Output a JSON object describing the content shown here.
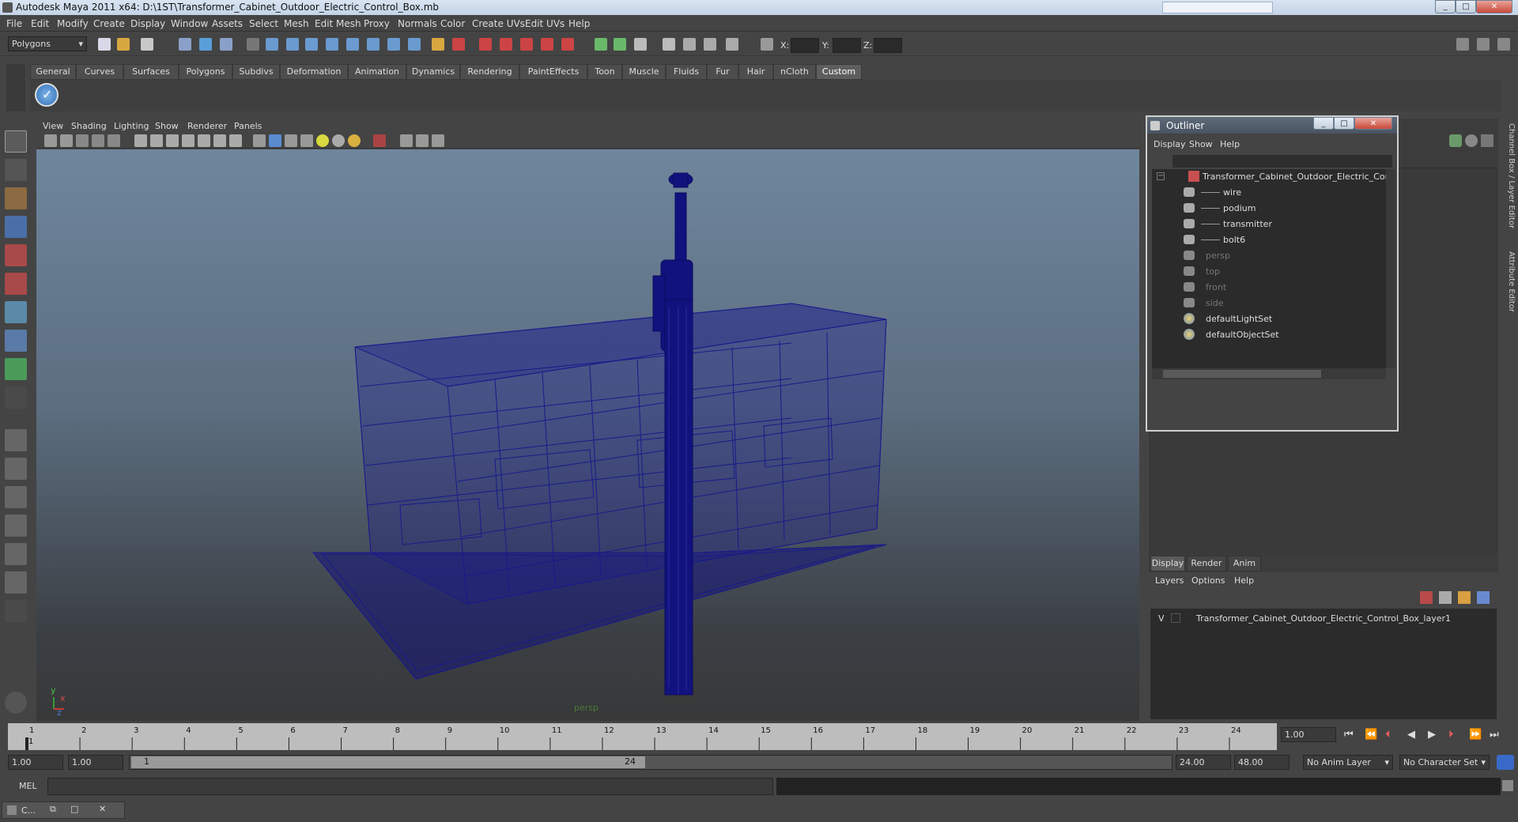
{
  "window": {
    "title": "Autodesk Maya 2011 x64: D:\\1ST\\Transformer_Cabinet_Outdoor_Electric_Control_Box.mb",
    "controls": [
      "_",
      "□",
      "✕"
    ]
  },
  "menu": [
    "File",
    "Edit",
    "Modify",
    "Create",
    "Display",
    "Window",
    "Assets",
    "Select",
    "Mesh",
    "Edit Mesh",
    "Proxy",
    "Normals",
    "Color",
    "Create UVs",
    "Edit UVs",
    "Help"
  ],
  "status_line": {
    "mode": "Polygons",
    "x_label": "X:",
    "y_label": "Y:",
    "z_label": "Z:"
  },
  "shelf": {
    "tabs": [
      "General",
      "Curves",
      "Surfaces",
      "Polygons",
      "Subdivs",
      "Deformation",
      "Animation",
      "Dynamics",
      "Rendering",
      "PaintEffects",
      "Toon",
      "Muscle",
      "Fluids",
      "Fur",
      "Hair",
      "nCloth",
      "Custom"
    ],
    "active_tab": "Custom"
  },
  "viewport": {
    "menu": [
      "View",
      "Shading",
      "Lighting",
      "Show",
      "Renderer",
      "Panels"
    ],
    "camera_label": "persp",
    "axis_y": "y",
    "axis_x": "x",
    "axis_z": "z"
  },
  "outliner": {
    "title": "Outliner",
    "menu": [
      "Display",
      "Show",
      "Help"
    ],
    "items": [
      {
        "label": "Transformer_Cabinet_Outdoor_Electric_Cont",
        "dim": false
      },
      {
        "label": "wire",
        "dim": false
      },
      {
        "label": "podium",
        "dim": false
      },
      {
        "label": "transmitter",
        "dim": false
      },
      {
        "label": "bolt6",
        "dim": false
      },
      {
        "label": "persp",
        "dim": true
      },
      {
        "label": "top",
        "dim": true
      },
      {
        "label": "front",
        "dim": true
      },
      {
        "label": "side",
        "dim": true
      },
      {
        "label": "defaultLightSet",
        "dim": false
      },
      {
        "label": "defaultObjectSet",
        "dim": false
      }
    ]
  },
  "side_tabs": [
    "Channel Box / Layer Editor",
    "Attribute Editor"
  ],
  "layer_editor": {
    "tabs": [
      "Display",
      "Render",
      "Anim"
    ],
    "active_tab": "Display",
    "menu": [
      "Layers",
      "Options",
      "Help"
    ],
    "layer": {
      "visible": "V",
      "name": "Transformer_Cabinet_Outdoor_Electric_Control_Box_layer1"
    }
  },
  "time_slider": {
    "ticks": [
      "1",
      "2",
      "3",
      "4",
      "5",
      "6",
      "7",
      "8",
      "9",
      "10",
      "11",
      "12",
      "13",
      "14",
      "15",
      "16",
      "17",
      "18",
      "19",
      "20",
      "21",
      "22",
      "23",
      "24"
    ],
    "current_frame": "1",
    "current_time_field": "1.00"
  },
  "range_slider": {
    "start_time": "1.00",
    "playback_start": "1.00",
    "range_start_label": "1",
    "range_end_label": "24",
    "playback_end": "24.00",
    "end_time": "48.00",
    "anim_layer": "No Anim Layer",
    "character_set": "No Character Set"
  },
  "command_line": {
    "label": "MEL"
  },
  "taskbar": {
    "item": "C..."
  }
}
